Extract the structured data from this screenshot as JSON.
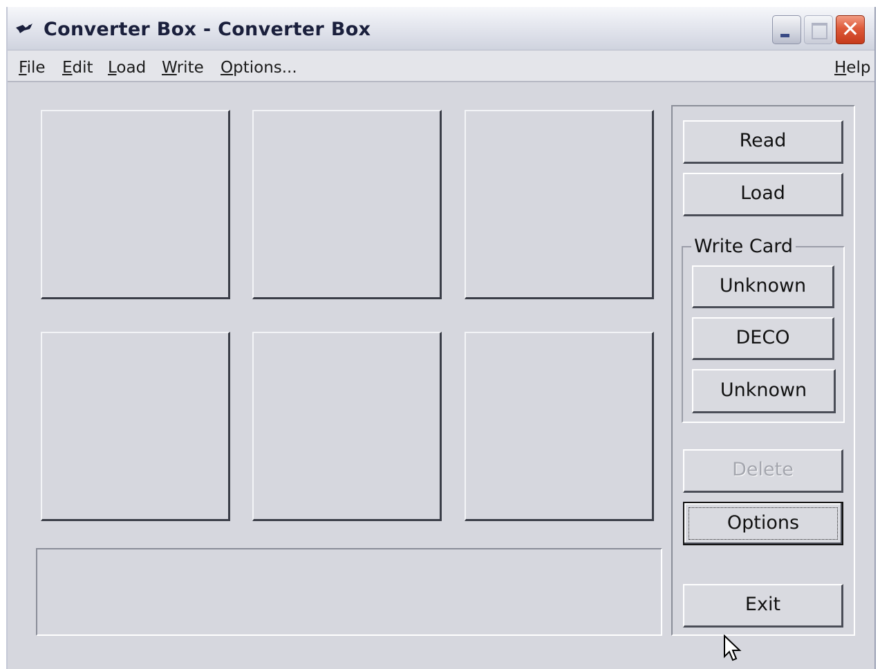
{
  "window": {
    "title": "Converter Box - Converter Box"
  },
  "title_bar": {
    "close_glyph": "✕"
  },
  "menu": {
    "file": "File",
    "edit": "Edit",
    "load": "Load",
    "write": "Write",
    "options": "Options...",
    "help": "Help"
  },
  "buttons": {
    "read": "Read",
    "load": "Load",
    "delete": "Delete",
    "options": "Options",
    "exit": "Exit"
  },
  "write_card": {
    "label": "Write Card",
    "unknown_1": "Unknown",
    "deco": "DECO",
    "unknown_2": "Unknown"
  },
  "icons": [
    "app-icon",
    "minimize-icon",
    "maximize-icon",
    "close-icon",
    "mouse-cursor-icon"
  ]
}
